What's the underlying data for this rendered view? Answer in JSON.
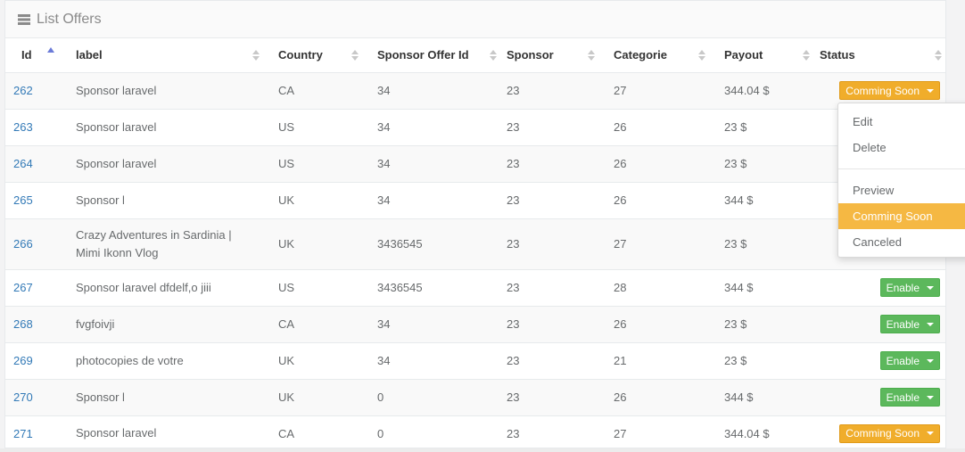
{
  "panel": {
    "title": "List Offers",
    "icon": "list-icon"
  },
  "table": {
    "headers": {
      "id": "Id",
      "label": "label",
      "country": "Country",
      "sponsor_offer_id": "Sponsor Offer Id",
      "sponsor": "Sponsor",
      "categorie": "Categorie",
      "payout": "Payout",
      "status": "Status"
    },
    "rows": [
      {
        "id": "262",
        "label": "Sponsor laravel",
        "country": "CA",
        "sponsor_offer_id": "34",
        "sponsor": "23",
        "categorie": "27",
        "payout": "344.04 $",
        "status": "Comming Soon"
      },
      {
        "id": "263",
        "label": "Sponsor laravel",
        "country": "US",
        "sponsor_offer_id": "34",
        "sponsor": "23",
        "categorie": "26",
        "payout": "23 $",
        "status": ""
      },
      {
        "id": "264",
        "label": "Sponsor laravel",
        "country": "US",
        "sponsor_offer_id": "34",
        "sponsor": "23",
        "categorie": "26",
        "payout": "23 $",
        "status": ""
      },
      {
        "id": "265",
        "label": "Sponsor l",
        "country": "UK",
        "sponsor_offer_id": "34",
        "sponsor": "23",
        "categorie": "26",
        "payout": "344 $",
        "status": ""
      },
      {
        "id": "266",
        "label": "Crazy Adventures in Sardinia | Mimi Ikonn Vlog",
        "country": "UK",
        "sponsor_offer_id": "3436545",
        "sponsor": "23",
        "categorie": "27",
        "payout": "23 $",
        "status": ""
      },
      {
        "id": "267",
        "label": "Sponsor laravel dfdelf,o jiii",
        "country": "US",
        "sponsor_offer_id": "3436545",
        "sponsor": "23",
        "categorie": "28",
        "payout": "344 $",
        "status": "Enable"
      },
      {
        "id": "268",
        "label": "fvgfoivji",
        "country": "CA",
        "sponsor_offer_id": "34",
        "sponsor": "23",
        "categorie": "26",
        "payout": "23 $",
        "status": "Enable"
      },
      {
        "id": "269",
        "label": "photocopies de votre",
        "country": "UK",
        "sponsor_offer_id": "34",
        "sponsor": "23",
        "categorie": "21",
        "payout": "23 $",
        "status": "Enable"
      },
      {
        "id": "270",
        "label": "Sponsor l",
        "country": "UK",
        "sponsor_offer_id": "0",
        "sponsor": "23",
        "categorie": "26",
        "payout": "344 $",
        "status": "Enable"
      },
      {
        "id": "271",
        "label": "Sponsor laravel",
        "country": "CA",
        "sponsor_offer_id": "0",
        "sponsor": "23",
        "categorie": "27",
        "payout": "344.04 $",
        "status": "Comming Soon"
      }
    ]
  },
  "dropdown": {
    "edit": "Edit",
    "delete": "Delete",
    "preview": "Preview",
    "comming_soon": "Comming Soon",
    "canceled": "Canceled"
  },
  "colors": {
    "link": "#337ab7",
    "soon": "#f0ad2b",
    "enable": "#5cb85c",
    "active_menu": "#f5b843"
  }
}
